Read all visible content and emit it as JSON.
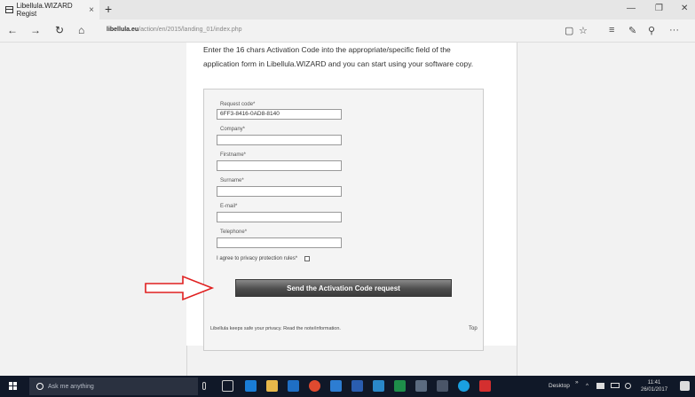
{
  "browser": {
    "tab_title": "Libellula.WIZARD Regist",
    "tab_close": "×",
    "new_tab": "+",
    "url_host": "libellula.eu",
    "url_path": "/action/en/2015/landing_01/index.php",
    "nav": {
      "back": "←",
      "forward": "→",
      "refresh": "↻",
      "home": "⌂"
    },
    "window": {
      "minimize": "—",
      "restore": "❐",
      "close": "✕"
    },
    "tools": {
      "reading": "▢",
      "favorite": "☆",
      "hub": "≡",
      "note": "✎",
      "share": "⚲",
      "more": "···"
    }
  },
  "page": {
    "intro_line1": "Enter the 16 chars Activation Code into the appropriate/specific field of the",
    "intro_line2": "application form in Libellula.WIZARD and you can start using your software copy.",
    "form": {
      "fields": [
        {
          "label": "Request code*",
          "value": "6FF3-8416-0AD8-8140"
        },
        {
          "label": "Company*",
          "value": ""
        },
        {
          "label": "Firstname*",
          "value": ""
        },
        {
          "label": "Surname*",
          "value": ""
        },
        {
          "label": "E-mail*",
          "value": ""
        },
        {
          "label": "Telephone*",
          "value": ""
        }
      ],
      "agree_label": "I agree to privacy protection rules*",
      "submit_label": "Send the Activation Code request"
    },
    "footer": {
      "privacy_note": "Libellula keeps safe your privacy. Read the note/information.",
      "top_link": "Top"
    },
    "accent_arrow_color": "#e02020"
  },
  "taskbar": {
    "search_placeholder": "Ask me anything",
    "tray_desktop": "Desktop",
    "tray_chevron": "»",
    "tray_up": "^",
    "time": "11:41",
    "date": "26/01/2017"
  }
}
